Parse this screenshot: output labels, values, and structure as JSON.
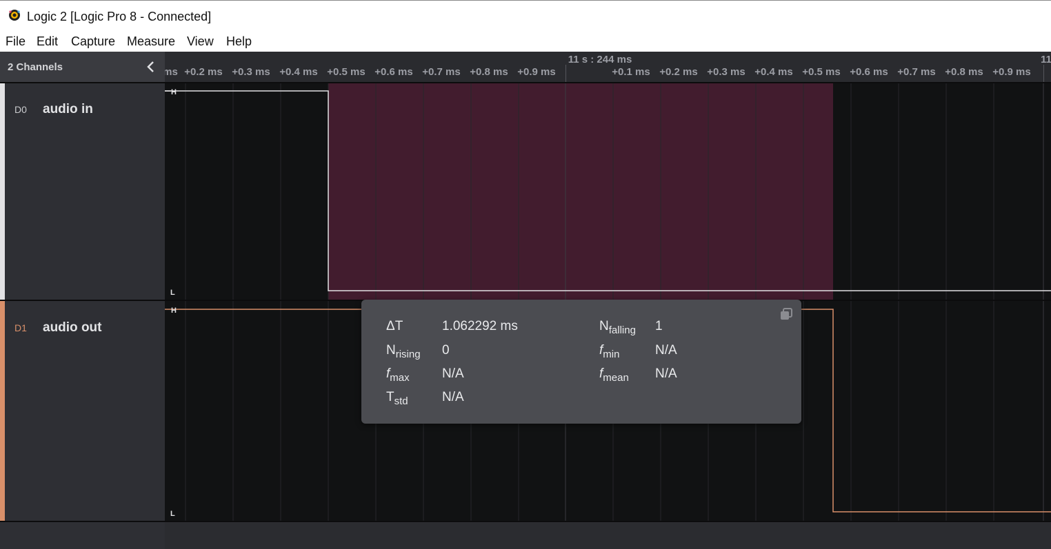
{
  "window": {
    "title": "Logic 2 [Logic Pro 8 - Connected]"
  },
  "menu": [
    "File",
    "Edit",
    "Capture",
    "Measure",
    "View",
    "Help"
  ],
  "sidebar": {
    "header": "2 Channels"
  },
  "timeline": {
    "center_label": "11 s : 244 ms",
    "right_edge_label": "11",
    "ticks": [
      "ms",
      "+0.2 ms",
      "+0.3 ms",
      "+0.4 ms",
      "+0.5 ms",
      "+0.6 ms",
      "+0.7 ms",
      "+0.8 ms",
      "+0.9 ms",
      "+0.1 ms",
      "+0.2 ms",
      "+0.3 ms",
      "+0.4 ms",
      "+0.5 ms",
      "+0.6 ms",
      "+0.7 ms",
      "+0.8 ms",
      "+0.9 ms"
    ]
  },
  "channels": [
    {
      "id": "D0",
      "name": "audio in",
      "color": "#e2e2e4",
      "high_label": "H",
      "low_label": "L"
    },
    {
      "id": "D1",
      "name": "audio out",
      "color": "#d9906a",
      "high_label": "H",
      "low_label": "L"
    }
  ],
  "measurement": {
    "delta_t": {
      "label": "ΔT",
      "value": "1.062292 ms"
    },
    "n_falling": {
      "label": "N",
      "sub": "falling",
      "value": "1"
    },
    "n_rising": {
      "label": "N",
      "sub": "rising",
      "value": "0"
    },
    "f_min": {
      "label": "f",
      "sub": "min",
      "value": "N/A"
    },
    "f_max": {
      "label": "f",
      "sub": "max",
      "value": "N/A"
    },
    "f_mean": {
      "label": "f",
      "sub": "mean",
      "value": "N/A"
    },
    "t_std": {
      "label": "T",
      "sub": "std",
      "value": "N/A"
    }
  },
  "colors": {
    "selection": "#421c2e",
    "waveform_bg": "#111213",
    "popup_bg": "#4b4c51"
  }
}
